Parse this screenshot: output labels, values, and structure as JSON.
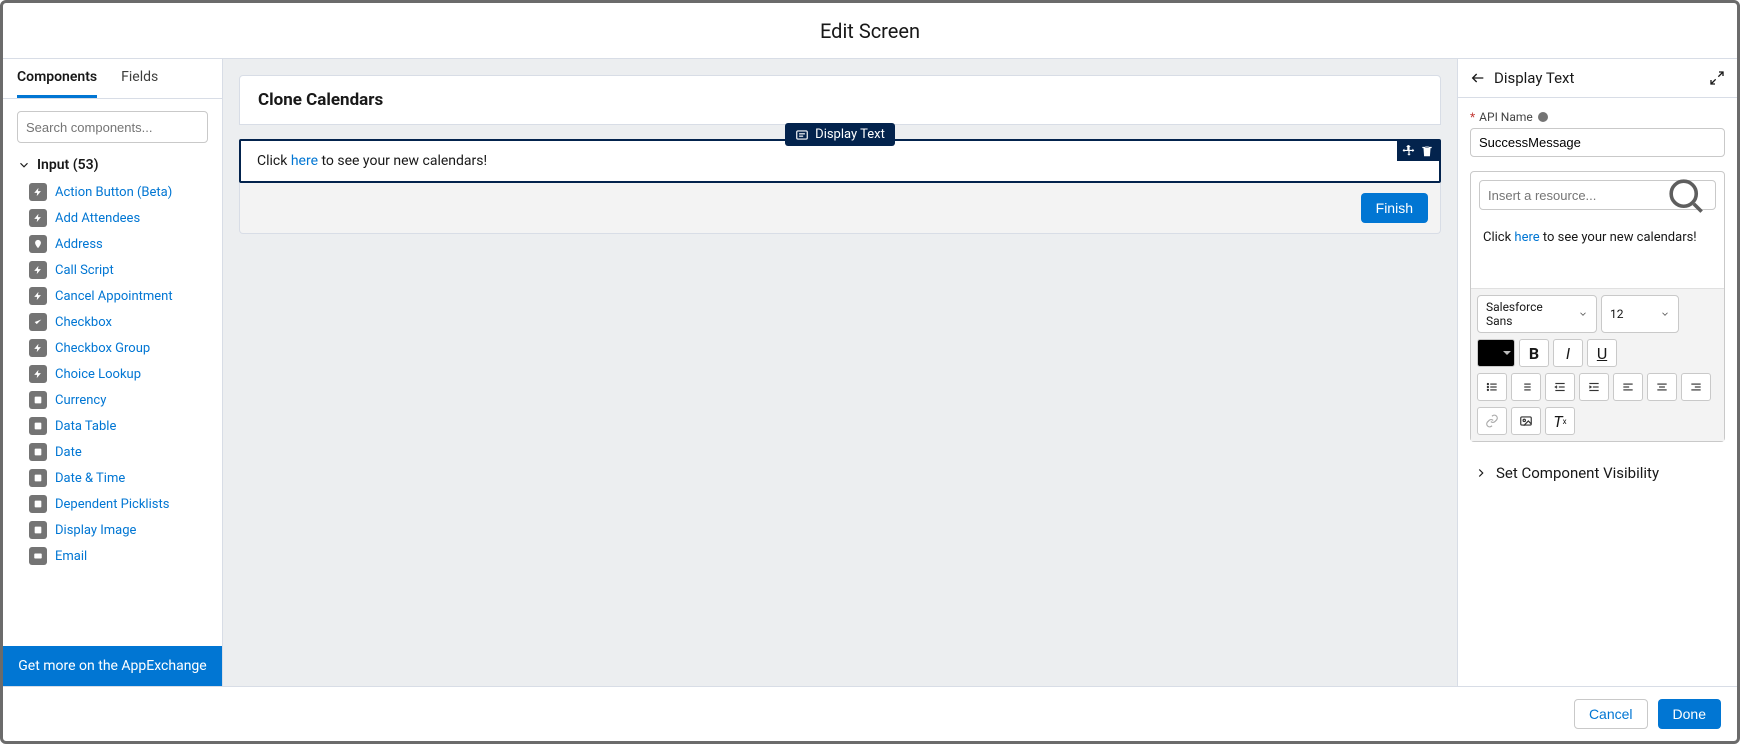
{
  "title": "Edit Screen",
  "left_panel": {
    "tabs": {
      "components": "Components",
      "fields": "Fields"
    },
    "search_placeholder": "Search components...",
    "group_label": "Input (53)",
    "items": [
      {
        "label": "Action Button (Beta)",
        "icon": "bolt"
      },
      {
        "label": "Add Attendees",
        "icon": "bolt"
      },
      {
        "label": "Address",
        "icon": "pin"
      },
      {
        "label": "Call Script",
        "icon": "bolt"
      },
      {
        "label": "Cancel Appointment",
        "icon": "bolt"
      },
      {
        "label": "Checkbox",
        "icon": "check"
      },
      {
        "label": "Checkbox Group",
        "icon": "bolt"
      },
      {
        "label": "Choice Lookup",
        "icon": "bolt"
      },
      {
        "label": "Currency",
        "icon": "box"
      },
      {
        "label": "Data Table",
        "icon": "box"
      },
      {
        "label": "Date",
        "icon": "box"
      },
      {
        "label": "Date & Time",
        "icon": "box"
      },
      {
        "label": "Dependent Picklists",
        "icon": "box"
      },
      {
        "label": "Display Image",
        "icon": "box"
      },
      {
        "label": "Email",
        "icon": "mail"
      }
    ],
    "appexchange": "Get more on the AppExchange"
  },
  "canvas": {
    "screen_title": "Clone Calendars",
    "display_text_tag": "Display Text",
    "body_prefix": "Click ",
    "body_link": "here",
    "body_suffix": " to see your new calendars!",
    "finish": "Finish"
  },
  "props": {
    "header": "Display Text",
    "api_name_label": "API Name",
    "api_name_value": "SuccessMessage",
    "resource_placeholder": "Insert a resource...",
    "rte_prefix": "Click ",
    "rte_link": "here",
    "rte_suffix": " to see your new calendars!",
    "font_family": "Salesforce Sans",
    "font_size": "12",
    "visibility": "Set Component Visibility"
  },
  "footer": {
    "cancel": "Cancel",
    "done": "Done"
  }
}
